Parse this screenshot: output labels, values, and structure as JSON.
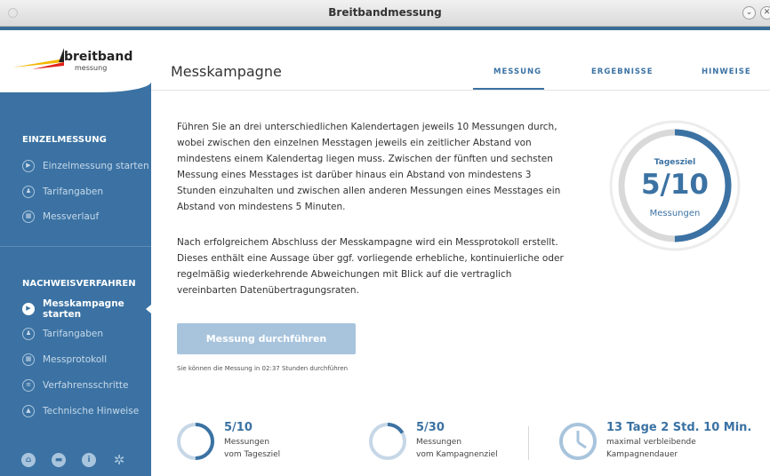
{
  "window": {
    "title": "Breitbandmessung",
    "minimize_label": "⌄",
    "close_label": "✕"
  },
  "logo": {
    "name": "breitband",
    "sub": "messung"
  },
  "sidebar": {
    "section1": "EINZELMESSUNG",
    "items1": [
      {
        "label": "Einzelmessung starten",
        "icon": "play-icon"
      },
      {
        "label": "Tarifangaben",
        "icon": "user-icon"
      },
      {
        "label": "Messverlauf",
        "icon": "calendar-icon"
      }
    ],
    "section2": "NACHWEISVERFAHREN",
    "items2": [
      {
        "label": "Messkampagne starten",
        "icon": "play-icon",
        "active": true
      },
      {
        "label": "Tarifangaben",
        "icon": "user-icon"
      },
      {
        "label": "Messprotokoll",
        "icon": "calendar-icon"
      },
      {
        "label": "Verfahrensschritte",
        "icon": "list-icon"
      },
      {
        "label": "Technische Hinweise",
        "icon": "warning-icon"
      }
    ],
    "bottom_icons": [
      "home-icon",
      "chat-icon",
      "info-icon",
      "gear-icon"
    ]
  },
  "main": {
    "title": "Messkampagne",
    "tabs": [
      "MESSUNG",
      "ERGEBNISSE",
      "HINWEISE"
    ],
    "paragraph1": "Führen Sie an drei unterschiedlichen Kalendertagen jeweils 10 Messungen durch, wobei zwischen den einzelnen Messtagen jeweils ein zeitlicher Abstand von mindestens einem Kalendertag liegen muss. Zwischen der fünften und sechsten Messung eines Messtages ist darüber hinaus ein Abstand von mindestens 3 Stunden einzuhalten und zwischen allen anderen Messungen eines Messtages ein Abstand von mindestens 5 Minuten.",
    "paragraph2": "Nach erfolgreichem Abschluss der Messkampagne wird ein Messprotokoll erstellt. Dieses enthält eine Aussage über ggf. vorliegende erhebliche, kontinuierliche oder regelmäßig wiederkehrende Abweichungen mit Blick auf die vertraglich vereinbarten Datenübertragungsraten.",
    "button": "Messung durchführen",
    "hint": "Sie können die Messung in 02:37 Stunden durchführen",
    "gauge": {
      "top": "Tagesziel",
      "value": "5/10",
      "bottom": "Messungen",
      "fraction": 0.5
    },
    "stats": [
      {
        "value": "5/10",
        "line1": "Messungen",
        "line2": "vom Tagesziel",
        "fraction": 0.5
      },
      {
        "value": "5/30",
        "line1": "Messungen",
        "line2": "vom Kampagnenziel",
        "fraction": 0.1667
      },
      {
        "value": "13 Tage 2 Std. 10 Min.",
        "line1": "maximal verbleibende",
        "line2": "Kampagnendauer"
      }
    ]
  },
  "colors": {
    "accent": "#3b72a3",
    "sidebar": "#3b72a3",
    "button_disabled": "#a8c4dd"
  }
}
